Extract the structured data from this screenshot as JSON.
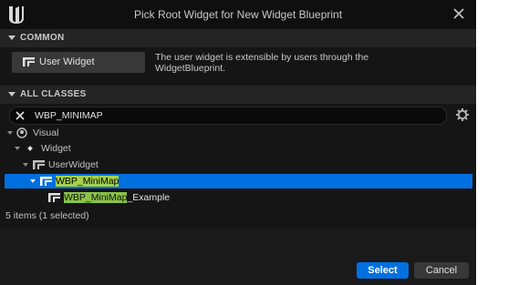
{
  "window": {
    "title": "Pick Root Widget for New Widget Blueprint"
  },
  "common": {
    "header": "COMMON",
    "button_label": "User Widget",
    "description": "The user widget is extensible by users through the WidgetBlueprint."
  },
  "all_classes": {
    "header": "ALL CLASSES",
    "search_value": "WBP_MINIMAP"
  },
  "tree": [
    {
      "label": "Visual",
      "highlight": "",
      "rest": ""
    },
    {
      "label": "Widget",
      "highlight": "",
      "rest": ""
    },
    {
      "label": "UserWidget",
      "highlight": "",
      "rest": ""
    },
    {
      "label": "",
      "highlight": "WBP_MiniMap",
      "rest": "",
      "selected": true
    },
    {
      "label": "",
      "highlight": "WBP_MiniMap",
      "rest": "_Example"
    }
  ],
  "status": "5 items (1 selected)",
  "buttons": {
    "select": "Select",
    "cancel": "Cancel"
  },
  "colors": {
    "accent": "#0070e0",
    "highlight": "#8bc34a",
    "background": "#151515"
  }
}
